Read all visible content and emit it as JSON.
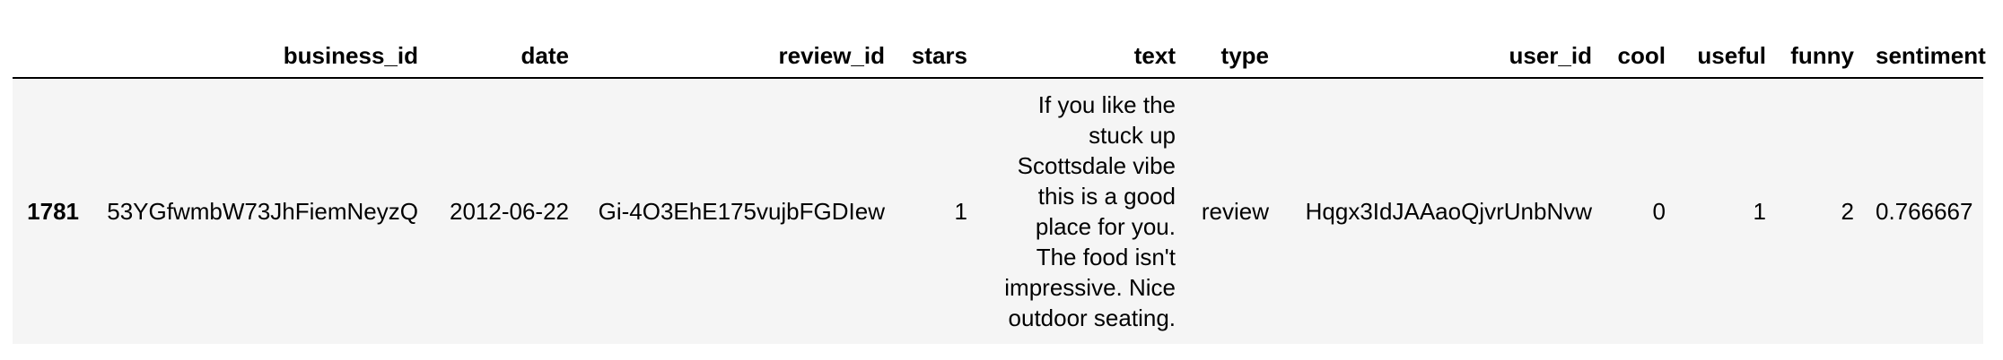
{
  "table": {
    "columns": [
      "",
      "business_id",
      "date",
      "review_id",
      "stars",
      "text",
      "type",
      "user_id",
      "cool",
      "useful",
      "funny",
      "sentiment"
    ],
    "rows": [
      {
        "index": "1781",
        "business_id": "53YGfwmbW73JhFiemNeyzQ",
        "date": "2012-06-22",
        "review_id": "Gi-4O3EhE175vujbFGDIew",
        "stars": "1",
        "text": "If you like the stuck up Scottsdale vibe this is a good place for you. The food isn't impressive. Nice outdoor seating.",
        "type": "review",
        "user_id": "Hqgx3IdJAAaoQjvrUnbNvw",
        "cool": "0",
        "useful": "1",
        "funny": "2",
        "sentiment": "0.766667"
      }
    ]
  }
}
